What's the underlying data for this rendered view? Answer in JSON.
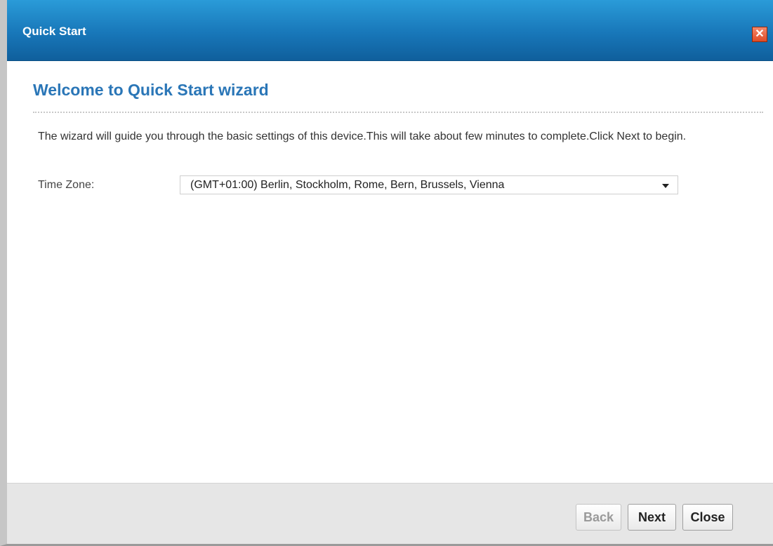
{
  "window": {
    "title": "Quick Start",
    "close_glyph": "✕"
  },
  "content": {
    "heading": "Welcome to Quick Start wizard",
    "description": "The wizard will guide you through the basic settings of this device.This will take about few minutes to complete.Click Next to begin.",
    "time_zone": {
      "label": "Time Zone:",
      "selected": "(GMT+01:00) Berlin, Stockholm, Rome, Bern, Brussels, Vienna"
    }
  },
  "footer": {
    "back_label": "Back",
    "next_label": "Next",
    "close_label": "Close",
    "back_disabled": true
  },
  "colors": {
    "titlebar": "#1877b9",
    "heading": "#2a76b7",
    "close_button": "#e04a25"
  }
}
